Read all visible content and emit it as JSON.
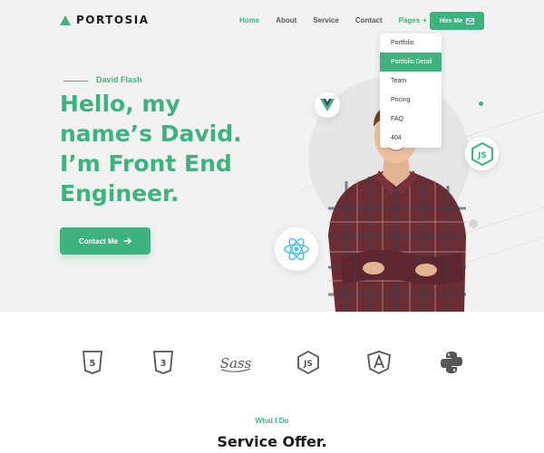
{
  "brand": {
    "name": "PORTOSIA",
    "accent": "#3fb37f"
  },
  "nav": {
    "items": [
      {
        "label": "Home"
      },
      {
        "label": "About"
      },
      {
        "label": "Service"
      },
      {
        "label": "Contact"
      },
      {
        "label": "Pages"
      }
    ],
    "pages_indicator": "+",
    "hire_label": "Hire Me"
  },
  "dropdown": {
    "items": [
      {
        "label": "Portfolio"
      },
      {
        "label": "Portfolio Detail"
      },
      {
        "label": "Team"
      },
      {
        "label": "Pricing"
      },
      {
        "label": "FAQ"
      },
      {
        "label": "404"
      }
    ]
  },
  "hero": {
    "subtitle": "David Flash",
    "headline": [
      "Hello, my",
      "name’s David.",
      "I’m Front End",
      "Engineer."
    ],
    "cta_label": "Contact Me",
    "badges": [
      "vue-icon",
      "nodejs-icon",
      "react-icon"
    ]
  },
  "tech_icons": [
    "html5-icon",
    "css3-icon",
    "sass-icon",
    "nodejs-icon",
    "angular-icon",
    "python-icon"
  ],
  "services": {
    "tag": "What I Do",
    "title": "Service Offer."
  }
}
